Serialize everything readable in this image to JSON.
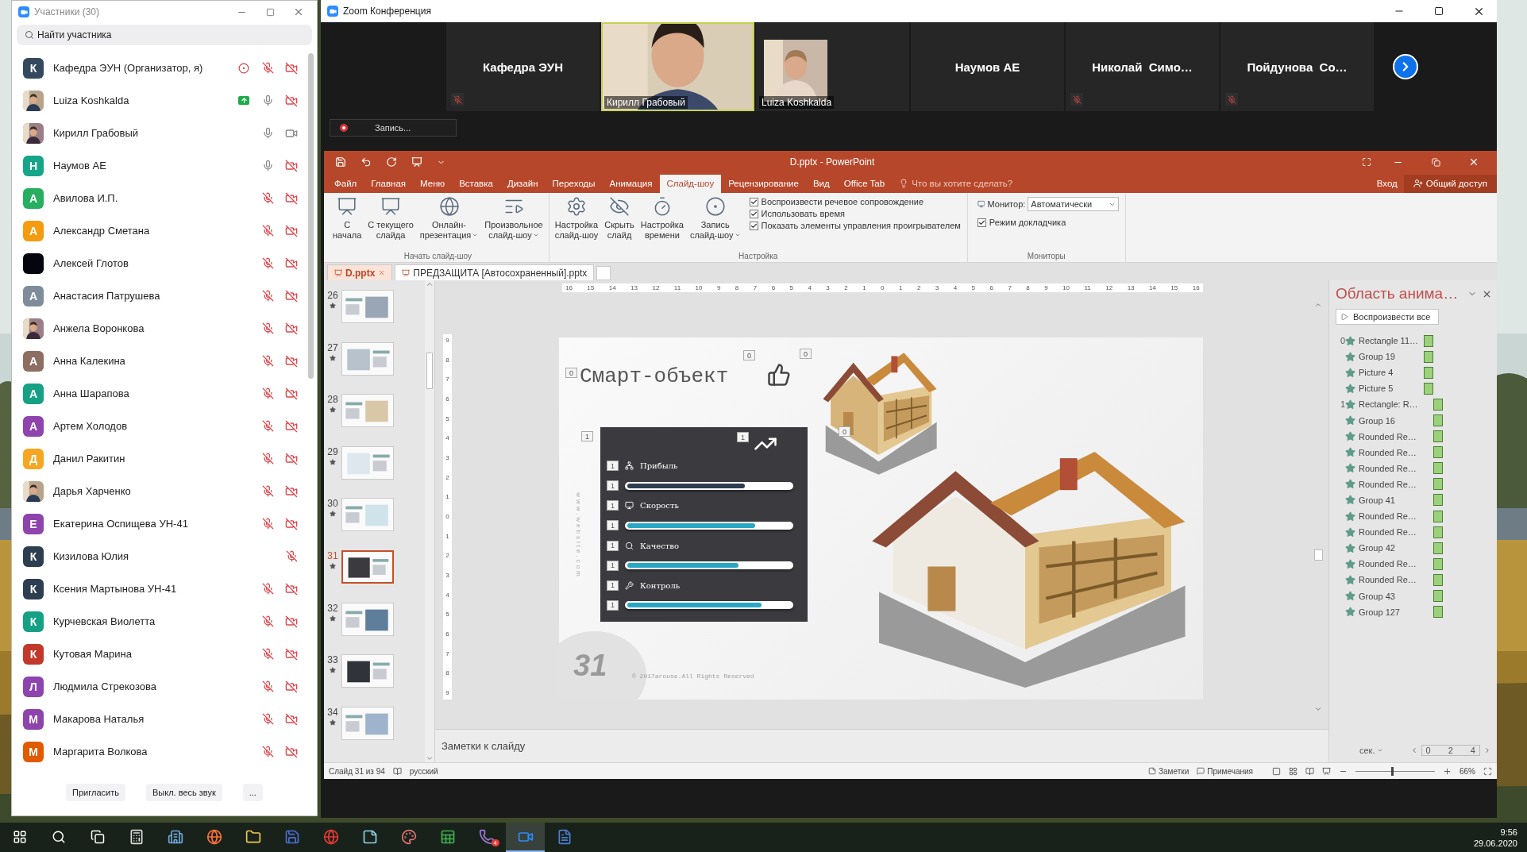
{
  "participants_window": {
    "title": "Участники (30)",
    "search": {
      "placeholder": "Найти участника"
    },
    "participants": [
      {
        "name": "Кафедра ЭУН (Организатор, я)",
        "avatar": {
          "kind": "letter",
          "letter": "К",
          "color": "#34495e"
        },
        "recording": true,
        "sharing": false,
        "mic_muted": true,
        "camera_on": false
      },
      {
        "name": "Luiza Koshkalda",
        "recording": false,
        "sharing": true,
        "mic_muted": false,
        "camera_on": false
      },
      {
        "name": "Кирилл Грабовый",
        "recording": false,
        "sharing": false,
        "mic_muted": false,
        "camera_on": true
      },
      {
        "name": "Наумов АЕ",
        "avatar": {
          "kind": "letter",
          "letter": "Н",
          "color": "#17a589"
        },
        "recording": false,
        "sharing": false,
        "mic_muted": false,
        "camera_on": false
      },
      {
        "name": "Авилова И.П.",
        "avatar": {
          "kind": "letter",
          "letter": "А",
          "color": "#27ae60"
        },
        "recording": false,
        "sharing": false,
        "mic_muted": true,
        "camera_on": false
      },
      {
        "name": "Александр Сметана",
        "avatar": {
          "kind": "letter",
          "letter": "А",
          "color": "#f39c12"
        },
        "recording": false,
        "sharing": false,
        "mic_muted": true,
        "camera_on": false
      },
      {
        "name": "Алексей Глотов",
        "avatar": {
          "kind": "letter",
          "color": "#050510"
        },
        "recording": false,
        "sharing": false,
        "mic_muted": true,
        "camera_on": false
      },
      {
        "name": "Анастасия Патрушева",
        "avatar": {
          "kind": "letter",
          "letter": "А",
          "color": "#7f8c9a"
        },
        "recording": false,
        "sharing": false,
        "mic_muted": true,
        "camera_on": false
      },
      {
        "name": "Анжела Воронкова",
        "recording": false,
        "sharing": false,
        "mic_muted": true,
        "camera_on": false
      },
      {
        "name": "Анна Калекина",
        "avatar": {
          "kind": "letter",
          "letter": "А",
          "color": "#8d6e63"
        },
        "recording": false,
        "sharing": false,
        "mic_muted": true,
        "camera_on": false
      },
      {
        "name": "Анна Шарапова",
        "avatar": {
          "kind": "letter",
          "letter": "А",
          "color": "#16a085"
        },
        "recording": false,
        "sharing": false,
        "mic_muted": true,
        "camera_on": false
      },
      {
        "name": "Артем Холодов",
        "avatar": {
          "kind": "letter",
          "letter": "А",
          "color": "#8e44ad"
        },
        "recording": false,
        "sharing": false,
        "mic_muted": true,
        "camera_on": false
      },
      {
        "name": "Данил Ракитин",
        "avatar": {
          "kind": "letter",
          "letter": "Д",
          "color": "#f5a623"
        },
        "recording": false,
        "sharing": false,
        "mic_muted": true,
        "camera_on": false
      },
      {
        "name": "Дарья Харченко",
        "recording": false,
        "sharing": false,
        "mic_muted": true,
        "camera_on": false
      },
      {
        "name": "Екатерина Оспищева УН-41",
        "avatar": {
          "kind": "letter",
          "letter": "Е",
          "color": "#8e44ad"
        },
        "recording": false,
        "sharing": false,
        "mic_muted": true,
        "camera_on": false
      },
      {
        "name": "Кизилова Юлия",
        "avatar": {
          "kind": "letter",
          "letter": "К",
          "color": "#2c3e50"
        },
        "recording": false,
        "sharing": false,
        "mic_muted": true
      },
      {
        "name": "Ксения Мартынова УН-41",
        "avatar": {
          "kind": "letter",
          "letter": "К",
          "color": "#2c3e50"
        },
        "recording": false,
        "sharing": false,
        "mic_muted": true,
        "camera_on": false
      },
      {
        "name": "Курчевская Виолетта",
        "avatar": {
          "kind": "letter",
          "letter": "К",
          "color": "#16a085"
        },
        "recording": false,
        "sharing": false,
        "mic_muted": true,
        "camera_on": false
      },
      {
        "name": "Кутовая Марина",
        "avatar": {
          "kind": "letter",
          "letter": "К",
          "color": "#c0392b"
        },
        "recording": false,
        "sharing": false,
        "mic_muted": true,
        "camera_on": false
      },
      {
        "name": "Людмила Стрекозова",
        "avatar": {
          "kind": "letter",
          "letter": "Л",
          "color": "#8e44ad"
        },
        "recording": false,
        "sharing": false,
        "mic_muted": true,
        "camera_on": false
      },
      {
        "name": "Макарова Наталья",
        "avatar": {
          "kind": "letter",
          "letter": "М",
          "color": "#8e44ad"
        },
        "recording": false,
        "sharing": false,
        "mic_muted": true,
        "camera_on": false
      },
      {
        "name": "Маргарита Волкова",
        "avatar": {
          "kind": "letter",
          "letter": "М",
          "color": "#e05a00"
        },
        "recording": false,
        "sharing": false,
        "mic_muted": true,
        "camera_on": false
      }
    ],
    "buttons": [
      "Пригласить",
      "Выкл. весь звук",
      "..."
    ]
  },
  "meeting_window": {
    "title": "Zoom Конференция",
    "tiles": [
      {
        "name": "Кафедра ЭУН",
        "kind": "name",
        "muted": true,
        "selected": false
      },
      {
        "name": "Кирилл Грабовый",
        "kind": "video",
        "muted": false,
        "selected": true
      },
      {
        "name": "Luiza Koshkalda",
        "muted": false,
        "selected": false
      },
      {
        "name": "Наумов АЕ",
        "kind": "name",
        "muted": false,
        "selected": false
      },
      {
        "name": "Николай  Симо…",
        "kind": "name",
        "muted": true,
        "selected": false
      },
      {
        "name": "Пойдунова  Со…",
        "kind": "name",
        "muted": true,
        "selected": false
      }
    ],
    "record_button": "Запись..."
  },
  "powerpoint": {
    "title": "D.pptx - PowerPoint",
    "tabs": [
      {
        "label": "Файл",
        "selected": false
      },
      {
        "label": "Главная",
        "selected": false
      },
      {
        "label": "Меню",
        "selected": false
      },
      {
        "label": "Вставка",
        "selected": false
      },
      {
        "label": "Дизайн",
        "selected": false
      },
      {
        "label": "Переходы",
        "selected": false
      },
      {
        "label": "Анимация",
        "selected": false
      },
      {
        "label": "Слайд-шоу",
        "selected": true
      },
      {
        "label": "Рецензирование",
        "selected": false
      },
      {
        "label": "Вид",
        "selected": false
      },
      {
        "label": "Office Tab",
        "selected": false
      }
    ],
    "search_hint": "Что вы хотите сделать?",
    "sign_in": "Вход",
    "share": "Общий доступ",
    "ribbon": [
      {
        "kind": "buttons",
        "label": "Начать слайд-шоу",
        "buttons": [
          {
            "lines": [
              "С",
              "начала"
            ],
            "dropdown": false
          },
          {
            "lines": [
              "С текущего",
              "слайда"
            ],
            "dropdown": false
          },
          {
            "lines": [
              "Онлайн-",
              "презентация"
            ],
            "dropdown": true
          },
          {
            "lines": [
              "Произвольное",
              "слайд-шоу"
            ],
            "dropdown": true
          }
        ]
      },
      {
        "kind": "setup",
        "label": "Настройка",
        "buttons": [
          {
            "lines": [
              "Настройка",
              "слайд-шоу"
            ],
            "dropdown": false
          },
          {
            "lines": [
              "Скрыть",
              "слайд"
            ],
            "dropdown": false
          },
          {
            "lines": [
              "Настройка",
              "времени"
            ],
            "dropdown": false
          },
          {
            "lines": [
              "Запись",
              "слайд-шоу"
            ],
            "dropdown": true
          }
        ],
        "checkboxes": [
          {
            "label": "Воспроизвести речевое сопровождение",
            "checked": true
          },
          {
            "label": "Использовать время",
            "checked": true
          },
          {
            "label": "Показать элементы управления проигрывателем",
            "checked": true
          }
        ]
      },
      {
        "kind": "monitors",
        "label": "Мониторы",
        "monitor_label": "Монитор:",
        "monitor_value": "Автоматически",
        "checkbox": {
          "label": "Режим докладчика",
          "checked": true
        }
      }
    ],
    "document_tabs": [
      {
        "label": "D.pptx",
        "selected": true
      },
      {
        "label": "ПРЕДЗАЩИТА [Автосохраненный].pptx",
        "selected": false
      }
    ],
    "ruler": {
      "horizontal": [
        "16",
        "15",
        "14",
        "13",
        "12",
        "11",
        "10",
        "9",
        "8",
        "7",
        "6",
        "5",
        "4",
        "3",
        "2",
        "1",
        "0",
        "1",
        "2",
        "3",
        "4",
        "5",
        "6",
        "7",
        "8",
        "9",
        "10",
        "11",
        "12",
        "13",
        "14",
        "15",
        "16"
      ],
      "vertical": [
        "9",
        "8",
        "7",
        "6",
        "5",
        "4",
        "3",
        "2",
        "1",
        "0",
        "1",
        "2",
        "3",
        "4",
        "5",
        "6",
        "7",
        "8",
        "9"
      ]
    },
    "thumbnails": [
      {
        "number": "26",
        "selected": false
      },
      {
        "number": "27",
        "selected": false
      },
      {
        "number": "28",
        "selected": false
      },
      {
        "number": "29",
        "selected": false
      },
      {
        "number": "30",
        "selected": false
      },
      {
        "number": "31",
        "selected": true
      },
      {
        "number": "32",
        "selected": false
      },
      {
        "number": "33",
        "selected": false
      },
      {
        "number": "34",
        "selected": false
      }
    ],
    "slide": {
      "title": "Смарт-объект",
      "markers": [
        "0",
        "0",
        "0",
        "1",
        "0"
      ],
      "chart_marker": "1",
      "metrics": [
        {
          "label": "Прибыль",
          "label_marker": "1",
          "bar_marker": "1",
          "level": 0.72,
          "color": "#2c3e50"
        },
        {
          "label": "Скорость",
          "label_marker": "1",
          "bar_marker": "1",
          "level": 0.78,
          "color": "#2aa7c4"
        },
        {
          "label": "Качество",
          "label_marker": "1",
          "bar_marker": "1",
          "level": 0.68,
          "color": "#2aa7c4"
        },
        {
          "label": "Контроль",
          "label_marker": "1",
          "bar_marker": "1",
          "level": 0.82,
          "color": "#2aa7c4"
        }
      ],
      "side_text": "www.website.com",
      "slide_number": "31",
      "footer": "© 2017arouse.All Rights Reserved"
    },
    "notes_placeholder": "Заметки к слайду",
    "animation_pane": {
      "title": "Область анима…",
      "play_button": "Воспроизвести все",
      "groups": [
        {
          "number": "0",
          "items": [
            "Rectangle 11…",
            "Group 19",
            "Picture 4",
            "Picture 5"
          ]
        },
        {
          "number": "1",
          "items": [
            "Rectangle: R…",
            "Group 16",
            "Rounded Re…",
            "Rounded Re…",
            "Rounded Re…",
            "Rounded Re…",
            "Group 41",
            "Rounded Re…",
            "Rounded Re…",
            "Group 42",
            "Rounded Re…",
            "Rounded Re…",
            "Group 43",
            "Group 127"
          ]
        }
      ],
      "unit": "сек.",
      "timeline": [
        "0",
        "2",
        "4"
      ]
    },
    "status_bar": {
      "slide": "Слайд 31 из 94",
      "language": "русский",
      "notes": "Заметки",
      "comments": "Примечания",
      "zoom": "66%",
      "zoom_slider": {
        "level": 0.45
      }
    }
  },
  "taskbar": {
    "apps": [
      {
        "kind": "calculator",
        "selected": false
      },
      {
        "kind": "building",
        "selected": false
      },
      {
        "kind": "browser",
        "selected": false
      },
      {
        "kind": "folder",
        "selected": false
      },
      {
        "kind": "floppy",
        "selected": false
      },
      {
        "kind": "yandex",
        "selected": false
      },
      {
        "kind": "notepad",
        "selected": false
      },
      {
        "kind": "palette",
        "selected": false
      },
      {
        "kind": "sheet",
        "selected": false
      },
      {
        "kind": "phone",
        "selected": false,
        "badge": "4"
      },
      {
        "kind": "camera",
        "selected": true
      },
      {
        "kind": "word",
        "selected": false
      }
    ],
    "time": "9:56",
    "date": "29.06.2020"
  }
}
